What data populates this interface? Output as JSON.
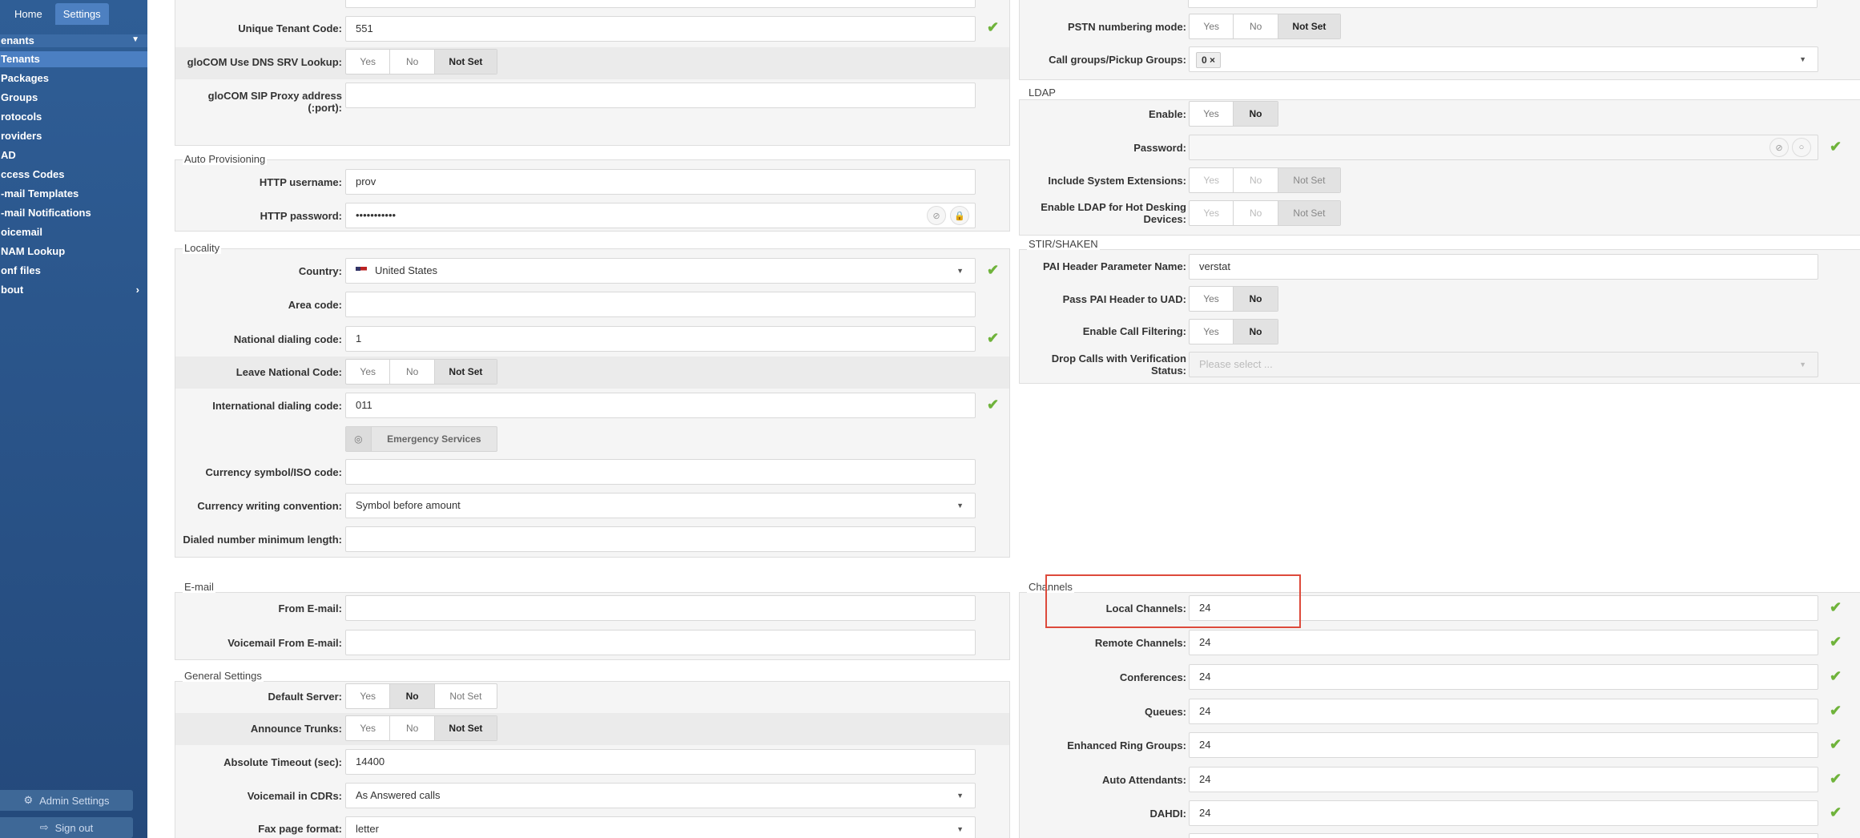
{
  "nav": {
    "home": "Home",
    "settings": "Settings"
  },
  "sidebar": {
    "header": "enants",
    "items": [
      {
        "label": "Tenants"
      },
      {
        "label": "Packages"
      },
      {
        "label": "Groups"
      },
      {
        "label": "rotocols"
      },
      {
        "label": "roviders"
      },
      {
        "label": "AD"
      },
      {
        "label": "ccess Codes"
      },
      {
        "label": "-mail Templates"
      },
      {
        "label": "-mail Notifications"
      },
      {
        "label": "oicemail"
      },
      {
        "label": "NAM Lookup"
      },
      {
        "label": "onf files"
      },
      {
        "label": "bout"
      }
    ],
    "admin_settings": "Admin Settings",
    "sign_out": "Sign out"
  },
  "segment": {
    "yes": "Yes",
    "no": "No",
    "not_set": "Not Set"
  },
  "left": {
    "unique_tenant_code": {
      "label": "Unique Tenant Code:",
      "value": "551"
    },
    "dns_srv": {
      "label": "gloCOM Use DNS SRV Lookup:"
    },
    "sip_proxy": {
      "label": "gloCOM SIP Proxy address (:port):",
      "value": ""
    },
    "auto_prov": {
      "legend": "Auto Provisioning",
      "http_user": {
        "label": "HTTP username:",
        "value": "prov"
      },
      "http_pass": {
        "label": "HTTP password:",
        "value": "•••••••••••"
      }
    },
    "locality": {
      "legend": "Locality",
      "country": {
        "label": "Country:",
        "value": "United States"
      },
      "area_code": {
        "label": "Area code:",
        "value": ""
      },
      "national_code": {
        "label": "National dialing code:",
        "value": "1"
      },
      "leave_national": {
        "label": "Leave National Code:"
      },
      "intl_code": {
        "label": "International dialing code:",
        "value": "011"
      },
      "emergency": "Emergency Services",
      "currency_symbol": {
        "label": "Currency symbol/ISO code:",
        "value": ""
      },
      "currency_conv": {
        "label": "Currency writing convention:",
        "value": "Symbol before amount"
      },
      "dialed_min": {
        "label": "Dialed number minimum length:",
        "value": ""
      }
    },
    "email": {
      "legend": "E-mail",
      "from": {
        "label": "From E-mail:",
        "value": ""
      },
      "vm_from": {
        "label": "Voicemail From E-mail:",
        "value": ""
      }
    },
    "general": {
      "legend": "General Settings",
      "default_server": {
        "label": "Default Server:"
      },
      "announce_trunks": {
        "label": "Announce Trunks:"
      },
      "abs_timeout": {
        "label": "Absolute Timeout (sec):",
        "value": "14400"
      },
      "vm_cdrs": {
        "label": "Voicemail in CDRs:",
        "value": "As Answered calls"
      },
      "fax_format": {
        "label": "Fax page format:",
        "value": "letter"
      }
    }
  },
  "right": {
    "pstn": {
      "label": "PSTN numbering mode:"
    },
    "call_groups": {
      "label": "Call groups/Pickup Groups:",
      "tag": "0 ×"
    },
    "ldap": {
      "legend": "LDAP",
      "enable": {
        "label": "Enable:"
      },
      "password": {
        "label": "Password:"
      },
      "include_sys": {
        "label": "Include System Extensions:"
      },
      "hot_desk": {
        "label": "Enable LDAP for Hot Desking Devices:"
      }
    },
    "stir": {
      "legend": "STIR/SHAKEN",
      "pai_name": {
        "label": "PAI Header Parameter Name:",
        "value": "verstat"
      },
      "pass_pai": {
        "label": "Pass PAI Header to UAD:"
      },
      "call_filter": {
        "label": "Enable Call Filtering:"
      },
      "drop_calls": {
        "label": "Drop Calls with Verification Status:",
        "placeholder": "Please select ..."
      }
    },
    "channels": {
      "legend": "Channels",
      "local": {
        "label": "Local Channels:",
        "value": "24"
      },
      "remote": {
        "label": "Remote Channels:",
        "value": "24"
      },
      "conferences": {
        "label": "Conferences:",
        "value": "24"
      },
      "queues": {
        "label": "Queues:",
        "value": "24"
      },
      "ring_groups": {
        "label": "Enhanced Ring Groups:",
        "value": "24"
      },
      "auto_att": {
        "label": "Auto Attendants:",
        "value": "24"
      },
      "dahdi": {
        "label": "DAHDI:",
        "value": "24"
      }
    }
  },
  "colors": {
    "sidebar": "#2f5e96",
    "active": "#4b7fc2",
    "check": "#6fb33b",
    "highlight": "#dd4a3b"
  }
}
